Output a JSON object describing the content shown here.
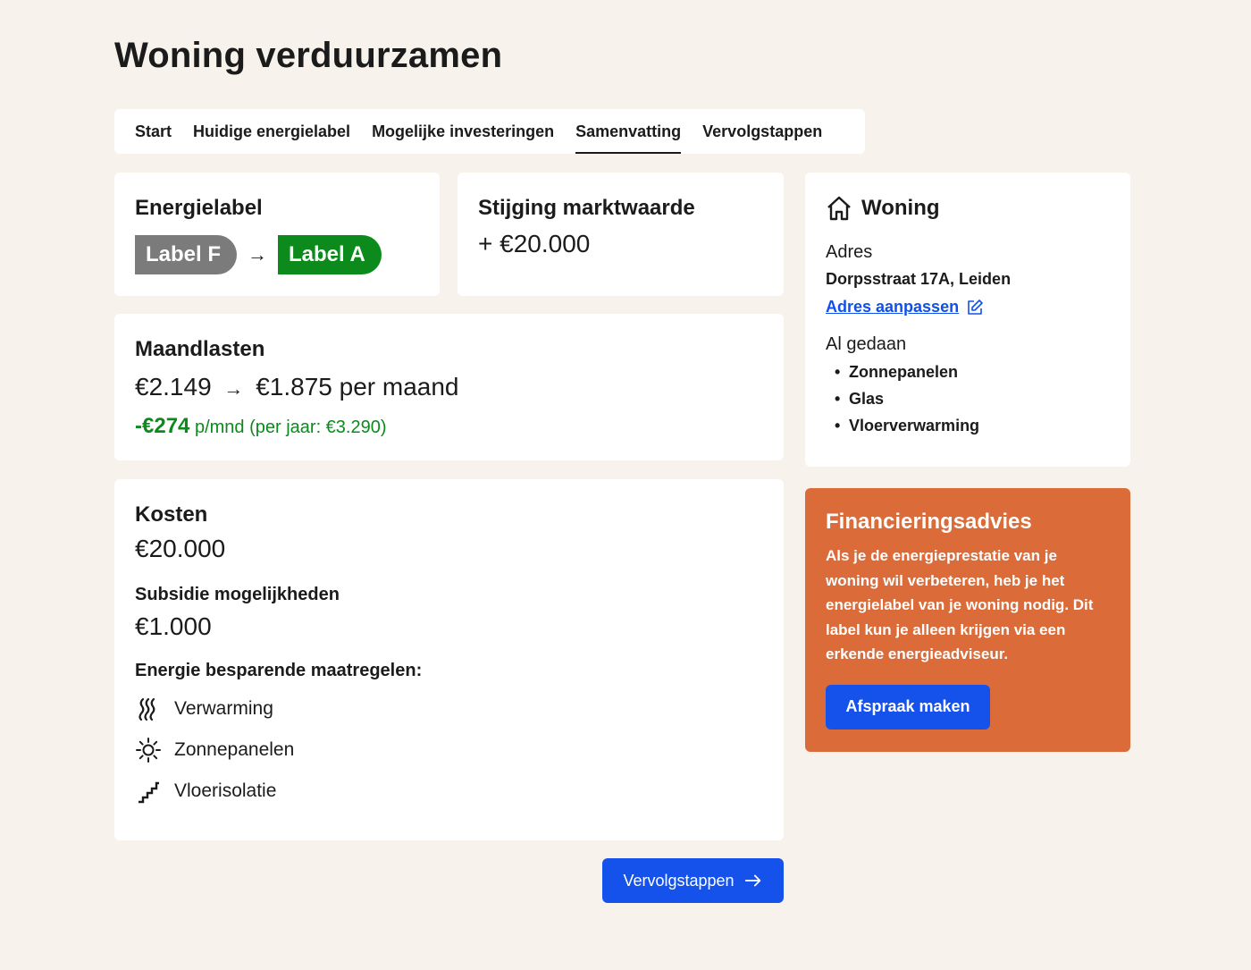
{
  "page": {
    "title": "Woning verduurzamen"
  },
  "tabs": [
    {
      "label": "Start"
    },
    {
      "label": "Huidige energielabel"
    },
    {
      "label": "Mogelijke investeringen"
    },
    {
      "label": "Samenvatting",
      "active": true
    },
    {
      "label": "Vervolgstappen"
    }
  ],
  "energielabel": {
    "title": "Energielabel",
    "from": "Label F",
    "to": "Label A",
    "arrow": "→"
  },
  "marktwaarde": {
    "title": "Stijging marktwaarde",
    "value": "+ €20.000"
  },
  "maandlasten": {
    "title": "Maandlasten",
    "from": "€2.149",
    "arrow": "→",
    "to": "€1.875 per maand",
    "saving_amount": "-€274",
    "saving_text": "p/mnd (per jaar: €3.290)"
  },
  "kosten": {
    "title": "Kosten",
    "value": "€20.000",
    "subsidie_title": "Subsidie mogelijkheden",
    "subsidie_value": "€1.000",
    "maatregelen_title": "Energie besparende maatregelen:",
    "maatregelen": [
      {
        "label": "Verwarming",
        "icon": "heat-waves-icon"
      },
      {
        "label": "Zonnepanelen",
        "icon": "sun-icon"
      },
      {
        "label": "Vloerisolatie",
        "icon": "stairs-icon"
      }
    ]
  },
  "woning": {
    "title": "Woning",
    "adres_label": "Adres",
    "adres_value": "Dorpsstraat 17A, Leiden",
    "adres_link": "Adres aanpassen",
    "gedaan_label": "Al gedaan",
    "gedaan": [
      "Zonnepanelen",
      "Glas",
      "Vloerverwarming"
    ]
  },
  "advies": {
    "title": "Financieringsadvies",
    "text": "Als je de energieprestatie van je woning wil verbeteren, heb je het energielabel van je woning nodig. Dit label kun je alleen krijgen via een erkende energieadviseur.",
    "button": "Afspraak maken"
  },
  "next_button": "Vervolgstappen",
  "colors": {
    "background": "#f7f2ec",
    "accent": "#1552ec",
    "green": "#0c8a1c",
    "advice": "#db6b39",
    "label_f": "#7b7b7b"
  }
}
